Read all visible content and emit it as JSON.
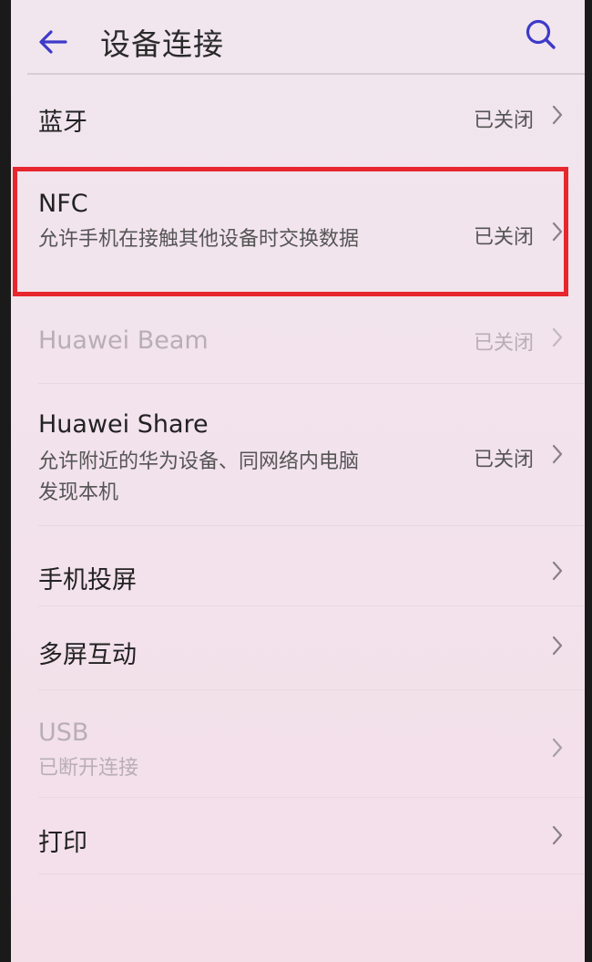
{
  "header": {
    "title": "设备连接"
  },
  "items": [
    {
      "label": "蓝牙",
      "status": "已关闭"
    },
    {
      "label": "NFC",
      "sub": "允许手机在接触其他设备时交换数据",
      "status": "已关闭"
    },
    {
      "label": "Huawei Beam",
      "status": "已关闭"
    },
    {
      "label": "Huawei Share",
      "sub": "允许附近的华为设备、同网络内电脑发现本机",
      "status": "已关闭"
    },
    {
      "label": "手机投屏"
    },
    {
      "label": "多屏互动"
    },
    {
      "label": "USB",
      "sub": "已断开连接"
    },
    {
      "label": "打印"
    }
  ],
  "colors": {
    "accent": "#3d3ac9",
    "highlight": "#e8262d"
  }
}
